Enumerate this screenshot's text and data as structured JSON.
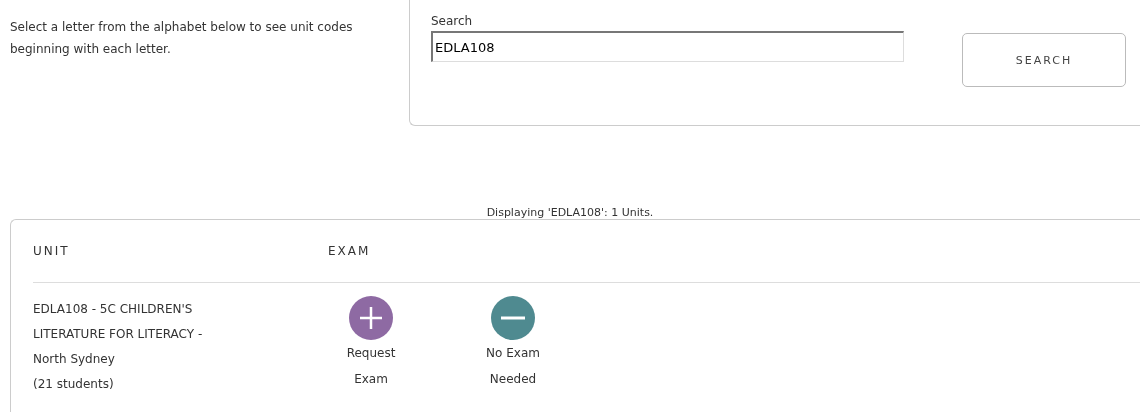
{
  "intro": "Select a letter from the alphabet below to see unit codes beginning with each letter.",
  "search": {
    "label": "Search",
    "value": "EDLA108",
    "button": "SEARCH"
  },
  "status": "Displaying 'EDLA108': 1 Units.",
  "table": {
    "columns": [
      "UNIT",
      "EXAM"
    ],
    "rows": [
      {
        "unit_lines": [
          "EDLA108 - 5C CHILDREN'S",
          "LITERATURE FOR LITERACY -",
          "North Sydney",
          "(21 students)"
        ],
        "actions": [
          {
            "kind": "add",
            "label": "Request Exam"
          },
          {
            "kind": "remove",
            "label": "No Exam Needed"
          }
        ]
      }
    ]
  }
}
